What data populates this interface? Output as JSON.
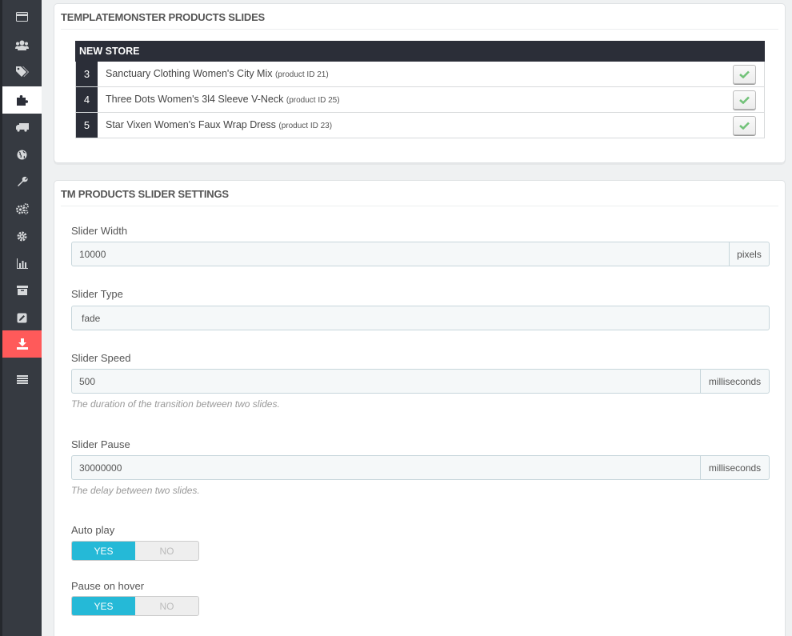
{
  "sidebar": {
    "items": [
      {
        "icon": "credit-card-icon",
        "state": "normal"
      },
      {
        "icon": "users-icon",
        "state": "normal"
      },
      {
        "icon": "tags-icon",
        "state": "normal"
      },
      {
        "icon": "puzzle-icon",
        "state": "active"
      },
      {
        "icon": "truck-icon",
        "state": "normal"
      },
      {
        "icon": "globe-icon",
        "state": "normal"
      },
      {
        "icon": "wrench-icon",
        "state": "normal"
      },
      {
        "icon": "cogs-icon",
        "state": "normal"
      },
      {
        "icon": "gear-icon",
        "state": "normal"
      },
      {
        "icon": "bar-chart-icon",
        "state": "normal"
      },
      {
        "icon": "archive-icon",
        "state": "normal"
      },
      {
        "icon": "edit-icon",
        "state": "normal"
      },
      {
        "icon": "download-icon",
        "state": "highlighted"
      },
      {
        "icon": "menu-icon",
        "state": "normal"
      }
    ]
  },
  "slides_panel": {
    "title": "TEMPLATEMONSTER PRODUCTS SLIDES",
    "store_name": "NEW STORE",
    "slides": [
      {
        "position": "3",
        "name": "Sanctuary Clothing Women's City Mix",
        "product_id": "(product ID 21)"
      },
      {
        "position": "4",
        "name": "Three Dots Women's 3l4 Sleeve V-Neck",
        "product_id": "(product ID 25)"
      },
      {
        "position": "5",
        "name": "Star Vixen Women's Faux Wrap Dress",
        "product_id": "(product ID 23)"
      }
    ]
  },
  "settings_panel": {
    "title": "TM PRODUCTS SLIDER SETTINGS",
    "slider_width": {
      "label": "Slider Width",
      "value": "10000",
      "unit": "pixels"
    },
    "slider_type": {
      "label": "Slider Type",
      "value": "fade"
    },
    "slider_speed": {
      "label": "Slider Speed",
      "value": "500",
      "unit": "milliseconds",
      "help": "The duration of the transition between two slides."
    },
    "slider_pause": {
      "label": "Slider Pause",
      "value": "30000000",
      "unit": "milliseconds",
      "help": "The delay between two slides."
    },
    "auto_play": {
      "label": "Auto play",
      "yes": "YES",
      "no": "NO",
      "selected": "YES"
    },
    "pause_on_hover": {
      "label": "Pause on hover",
      "yes": "YES",
      "no": "NO",
      "selected": "YES"
    }
  },
  "colors": {
    "sidebar_bg": "#363a41",
    "accent": "#25b9d7",
    "highlight_red": "#ff5a5a",
    "table_header": "#2b2e38",
    "check_green": "#72c279"
  }
}
